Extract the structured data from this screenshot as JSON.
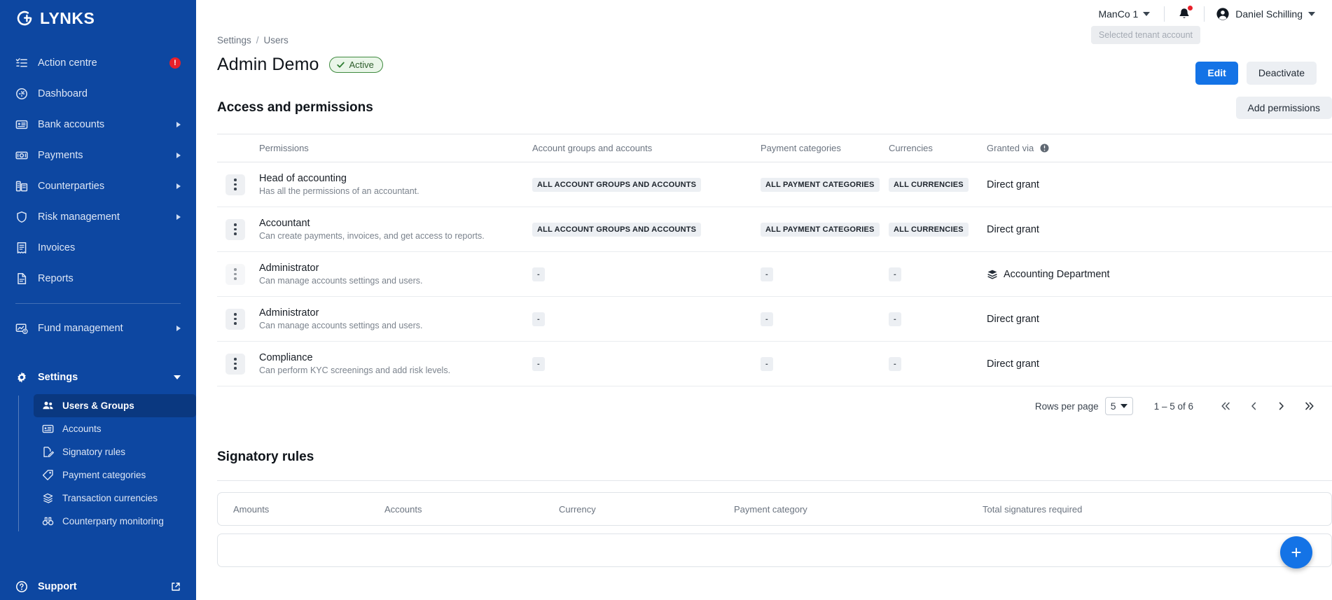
{
  "brand": {
    "name": "LYNKS",
    "sidebar_color": "#0d47a1",
    "accent_color": "#1473e6"
  },
  "sidebar": {
    "items": [
      {
        "label": "Action centre",
        "icon": "list-checks-icon",
        "badge": "!",
        "expandable": false
      },
      {
        "label": "Dashboard",
        "icon": "speedometer-icon",
        "expandable": false
      },
      {
        "label": "Bank accounts",
        "icon": "card-icon",
        "expandable": true
      },
      {
        "label": "Payments",
        "icon": "banknote-icon",
        "expandable": true
      },
      {
        "label": "Counterparties",
        "icon": "building-icon",
        "expandable": true
      },
      {
        "label": "Risk management",
        "icon": "shield-icon",
        "expandable": true
      },
      {
        "label": "Invoices",
        "icon": "invoice-icon",
        "expandable": false
      },
      {
        "label": "Reports",
        "icon": "document-icon",
        "expandable": false
      }
    ],
    "fund_management": {
      "label": "Fund management",
      "icon": "fund-chart-icon",
      "expandable": true
    },
    "settings": {
      "label": "Settings",
      "icon": "gear-icon",
      "expanded": true
    },
    "settings_children": [
      {
        "label": "Users & Groups",
        "icon": "users-icon",
        "active": true
      },
      {
        "label": "Accounts",
        "icon": "card-icon",
        "active": false
      },
      {
        "label": "Signatory rules",
        "icon": "signature-icon",
        "active": false
      },
      {
        "label": "Payment categories",
        "icon": "tag-icon",
        "active": false
      },
      {
        "label": "Transaction currencies",
        "icon": "coins-icon",
        "active": false
      },
      {
        "label": "Counterparty monitoring",
        "icon": "binoculars-icon",
        "active": false
      }
    ],
    "support": {
      "label": "Support",
      "icon": "help-circle-icon",
      "external_icon": "external-link-icon"
    }
  },
  "topbar": {
    "tenant": "ManCo 1",
    "tenant_tooltip": "Selected tenant account",
    "notifications_icon": "bell-icon",
    "user": "Daniel Schilling",
    "avatar_icon": "user-avatar-icon"
  },
  "breadcrumb": {
    "items": [
      "Settings",
      "Users"
    ],
    "separator": "/"
  },
  "header": {
    "title": "Admin Demo",
    "status": "Active",
    "status_icon": "check-icon",
    "edit_label": "Edit",
    "deactivate_label": "Deactivate"
  },
  "permissions_section": {
    "title": "Access and permissions",
    "add_label": "Add permissions",
    "columns": [
      "Permissions",
      "Account groups and accounts",
      "Payment categories",
      "Currencies",
      "Granted via"
    ],
    "granted_via_info_icon": "info-icon",
    "rows": [
      {
        "name": "Head of accounting",
        "description": "Has all the permissions of an accountant.",
        "account_groups": "ALL ACCOUNT GROUPS AND ACCOUNTS",
        "payment_categories": "ALL PAYMENT CATEGORIES",
        "currencies": "ALL CURRENCIES",
        "granted_via": "Direct grant",
        "granted_via_icon": null
      },
      {
        "name": "Accountant",
        "description": "Can create payments, invoices, and get access to reports.",
        "account_groups": "ALL ACCOUNT GROUPS AND ACCOUNTS",
        "payment_categories": "ALL PAYMENT CATEGORIES",
        "currencies": "ALL CURRENCIES",
        "granted_via": "Direct grant",
        "granted_via_icon": null
      },
      {
        "name": "Administrator",
        "description": "Can manage accounts settings and users.",
        "account_groups": "-",
        "payment_categories": "-",
        "currencies": "-",
        "granted_via": "Accounting Department",
        "granted_via_icon": "layers-icon"
      },
      {
        "name": "Administrator",
        "description": "Can manage accounts settings and users.",
        "account_groups": "-",
        "payment_categories": "-",
        "currencies": "-",
        "granted_via": "Direct grant",
        "granted_via_icon": null
      },
      {
        "name": "Compliance",
        "description": "Can perform KYC screenings and add risk levels.",
        "account_groups": "-",
        "payment_categories": "-",
        "currencies": "-",
        "granted_via": "Direct grant",
        "granted_via_icon": null
      }
    ],
    "pagination": {
      "rows_per_page_label": "Rows per page",
      "rows_per_page_value": "5",
      "range": "1 – 5 of 6",
      "first_icon": "chevrons-left-icon",
      "prev_icon": "chevron-left-icon",
      "next_icon": "chevron-right-icon",
      "last_icon": "chevrons-right-icon"
    }
  },
  "signatory_section": {
    "title": "Signatory rules",
    "columns": [
      "Amounts",
      "Accounts",
      "Currency",
      "Payment category",
      "Total signatures required"
    ]
  },
  "fab": {
    "icon": "plus-icon",
    "label": "+"
  }
}
